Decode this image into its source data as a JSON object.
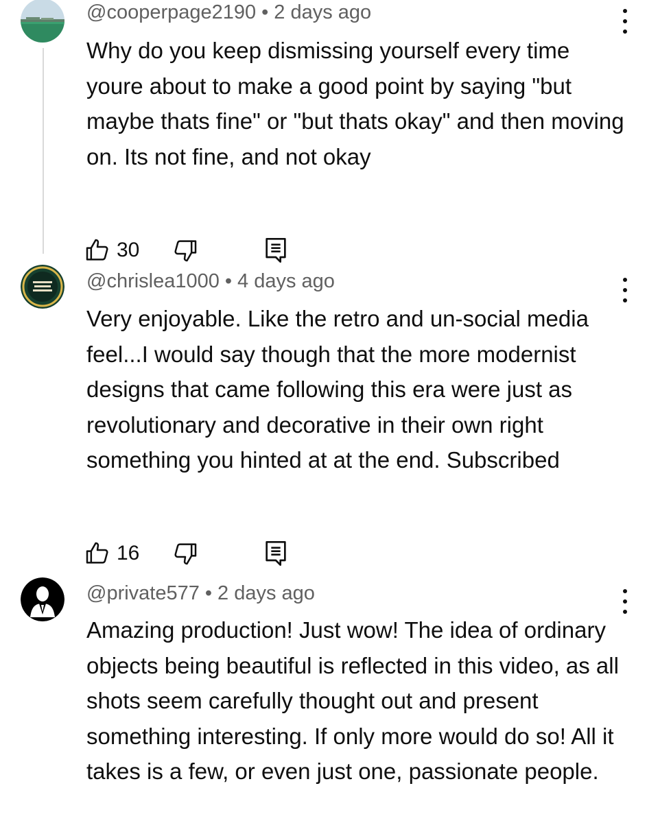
{
  "comments": [
    {
      "handle": "@cooperpage2190",
      "separator": "•",
      "time": "2 days ago",
      "text": "Why do you keep dismissing yourself every time youre about to make a good point by saying \"but maybe thats fine\" or \"but thats okay\" and then moving on. Its not fine, and not okay",
      "likes": "30",
      "avatar_icon": "landscape-avatar-icon"
    },
    {
      "handle": "@chrislea1000",
      "separator": "•",
      "time": "4 days ago",
      "text": "Very enjoyable. Like the retro and un-social media feel...I would say though that the more modernist designs that came following this era were just as revolutionary and decorative in their own right something you hinted at at the end. Subscribed",
      "likes": "16",
      "avatar_icon": "emblem-avatar-icon"
    },
    {
      "handle": "@private577",
      "separator": "•",
      "time": "2 days ago",
      "text": "Amazing production! Just wow! The idea of ordinary objects being beautiful is reflected in this video, as all shots seem carefully thought out and present something interesting. If only more would do so! All it takes is a few, or even just one, passionate people.",
      "likes": "",
      "avatar_icon": "suit-figure-avatar-icon"
    }
  ],
  "icons": {
    "like": "thumbs-up-icon",
    "dislike": "thumbs-down-icon",
    "reply": "reply-icon",
    "more": "more-vertical-icon"
  },
  "colors": {
    "text": "#0f0f0f",
    "meta": "#606060",
    "thread_line": "#d9d9d9"
  }
}
